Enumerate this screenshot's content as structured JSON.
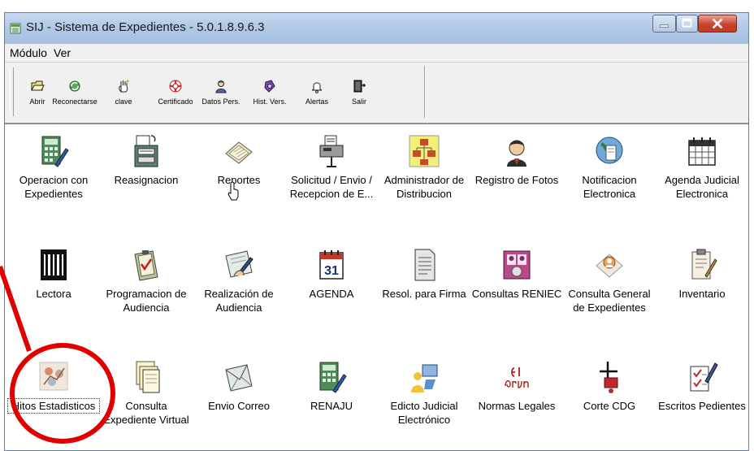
{
  "window": {
    "title": "SIJ - Sistema de Expedientes - 5.0.1.8.9.6.3"
  },
  "menu": {
    "items": [
      "Módulo",
      "Ver"
    ]
  },
  "toolbar": {
    "buttons": [
      {
        "label": "Abrir",
        "icon": "open-folder-icon"
      },
      {
        "label": "Reconectarse",
        "icon": "reconnect-icon"
      },
      {
        "label": "clave",
        "icon": "hand-key-icon"
      },
      {
        "label": "Certificado",
        "icon": "lifebuoy-icon"
      },
      {
        "label": "Datos Pers.",
        "icon": "person-icon"
      },
      {
        "label": "Hist. Vers.",
        "icon": "history-icon"
      },
      {
        "label": "Alertas",
        "icon": "bell-icon"
      },
      {
        "label": "Salir",
        "icon": "exit-door-icon"
      }
    ]
  },
  "modules": {
    "row1": [
      {
        "label": "Operacion con Expedientes",
        "icon": "calculator-pen-icon"
      },
      {
        "label": "Reasignacion",
        "icon": "tray-documents-icon"
      },
      {
        "label": "Reportes",
        "icon": "papers-icon"
      },
      {
        "label": "Solicitud / Envio / Recepcion de E...",
        "icon": "hand-fax-icon"
      },
      {
        "label": "Administrador de Distribucion",
        "icon": "org-chart-icon"
      },
      {
        "label": "Registro de Fotos",
        "icon": "person-photo-icon"
      },
      {
        "label": "Notificacion Electronica",
        "icon": "globe-document-icon"
      },
      {
        "label": "Agenda Judicial Electronica",
        "icon": "calendar-clock-icon"
      }
    ],
    "row2": [
      {
        "label": "Lectora",
        "icon": "barcode-icon"
      },
      {
        "label": "Programacion de Audiencia",
        "icon": "clipboard-check-icon"
      },
      {
        "label": "Realización de Audiencia",
        "icon": "writing-hand-icon"
      },
      {
        "label": "AGENDA",
        "icon": "calendar-31-icon"
      },
      {
        "label": "Resol. para Firma",
        "icon": "document-lines-icon"
      },
      {
        "label": "Consultas RENIEC",
        "icon": "id-people-icon"
      },
      {
        "label": "Consulta General de Expedientes",
        "icon": "search-user-icon"
      },
      {
        "label": "Inventario",
        "icon": "clipboard-pencil-icon"
      }
    ],
    "row3": [
      {
        "label": "Hitos Estadisticos",
        "icon": "statistics-milestones-icon"
      },
      {
        "label": "Consulta Expediente Virtual",
        "icon": "stacked-documents-icon"
      },
      {
        "label": "Envio Correo",
        "icon": "envelope-icon"
      },
      {
        "label": "RENAJU",
        "icon": "calculator-pen-icon"
      },
      {
        "label": "Edicto Judicial Electrónico",
        "icon": "person-monitor-icon"
      },
      {
        "label": "Normas Legales",
        "icon": "el-peruano-logo-icon"
      },
      {
        "label": "Corte CDG",
        "icon": "cross-stamp-icon"
      },
      {
        "label": "Escritos Pedientes",
        "icon": "checklist-pen-icon"
      }
    ]
  },
  "annotation": {
    "color": "#e00000"
  }
}
